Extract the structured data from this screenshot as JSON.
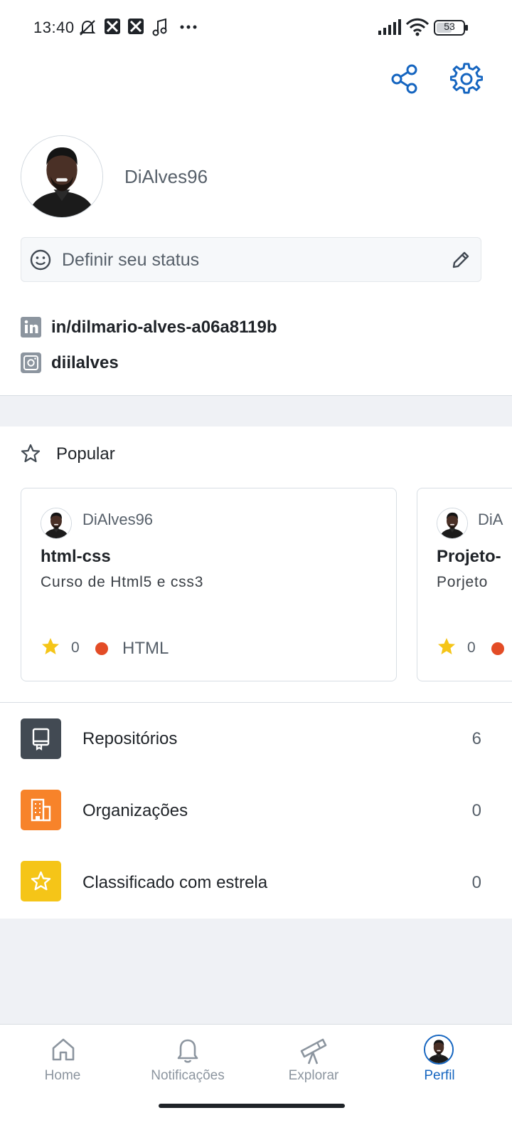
{
  "status_bar": {
    "time": "13:40",
    "battery": "53",
    "icons": [
      "mute-icon",
      "app-icon",
      "app-icon",
      "music-icon",
      "more-icon",
      "signal-icon",
      "wifi-icon",
      "battery-icon"
    ]
  },
  "header": {
    "actions": [
      "share-icon",
      "settings-icon"
    ]
  },
  "profile": {
    "username": "DiAlves96",
    "status_placeholder": "Definir seu status",
    "links": [
      {
        "icon": "linkedin-icon",
        "text": "in/dilmario-alves-a06a8119b"
      },
      {
        "icon": "instagram-icon",
        "text": "diilalves"
      }
    ]
  },
  "popular": {
    "title": "Popular",
    "cards": [
      {
        "owner": "DiAlves96",
        "repo": "html-css",
        "description": "Curso de Html5 e css3",
        "stars": "0",
        "language": "HTML"
      },
      {
        "owner": "DiA",
        "repo": "Projeto-",
        "description": "Porjeto",
        "stars": "0",
        "language": ""
      }
    ]
  },
  "list": [
    {
      "label": "Repositórios",
      "count": "6",
      "icon": "repo-icon",
      "color": "#424a53"
    },
    {
      "label": "Organizações",
      "count": "0",
      "icon": "organization-icon",
      "color": "#f7832a"
    },
    {
      "label": "Classificado com estrela",
      "count": "0",
      "icon": "star-icon",
      "color": "#f5c518"
    }
  ],
  "bottom_nav": [
    {
      "label": "Home",
      "icon": "home-icon",
      "active": false
    },
    {
      "label": "Notificações",
      "icon": "bell-icon",
      "active": false
    },
    {
      "label": "Explorar",
      "icon": "telescope-icon",
      "active": false
    },
    {
      "label": "Perfil",
      "icon": "avatar-icon",
      "active": true
    }
  ],
  "colors": {
    "accent": "#1565c0",
    "lang_html": "#e34c26",
    "star": "#f5c518"
  }
}
